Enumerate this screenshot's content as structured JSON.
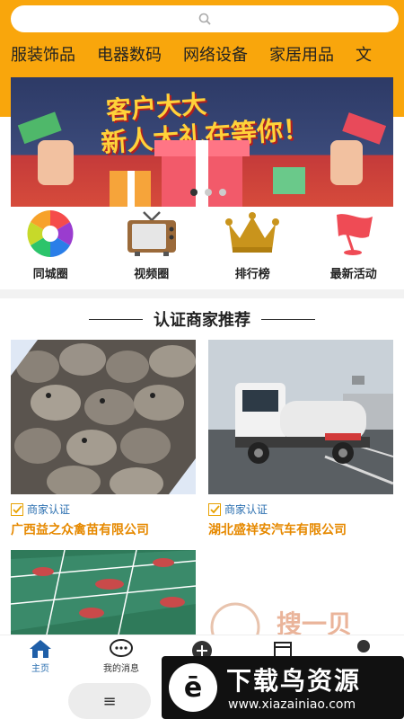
{
  "search": {
    "icon": "search-icon"
  },
  "categories": [
    "服装饰品",
    "电器数码",
    "网络设备",
    "家居用品",
    "文"
  ],
  "banner": {
    "line1": "客户大大",
    "line2": "新人大礼在等你！"
  },
  "shortcuts": [
    {
      "label": "同城圈",
      "icon": "aperture-icon"
    },
    {
      "label": "视频圈",
      "icon": "tv-icon"
    },
    {
      "label": "排行榜",
      "icon": "crown-icon"
    },
    {
      "label": "最新活动",
      "icon": "flag-icon"
    }
  ],
  "section": {
    "title": "认证商家推荐"
  },
  "cards": [
    {
      "badge": "商家认证",
      "name": "广西益之众禽苗有限公司"
    },
    {
      "badge": "商家认证",
      "name": "湖北盛祥安汽车有限公司"
    },
    {
      "badge": "",
      "name": ""
    },
    {
      "badge": "",
      "name": ""
    }
  ],
  "card4_overlay": "搜一贝",
  "tabs": [
    {
      "label": "主页",
      "icon": "home-icon"
    },
    {
      "label": "我的消息",
      "icon": "chat-icon"
    },
    {
      "label": "",
      "icon": "plus-icon"
    },
    {
      "label": "",
      "icon": "store-icon"
    },
    {
      "label": "",
      "icon": "user-icon"
    }
  ],
  "system_nav": {
    "menu_glyph": "≡"
  },
  "watermark": {
    "logo": "ē",
    "title": "下载鸟资源",
    "url": "www.xiazainiao.com"
  },
  "colors": {
    "accent": "#f9a60c",
    "badge_blue": "#2b6fb0",
    "name_orange": "#e68900"
  }
}
